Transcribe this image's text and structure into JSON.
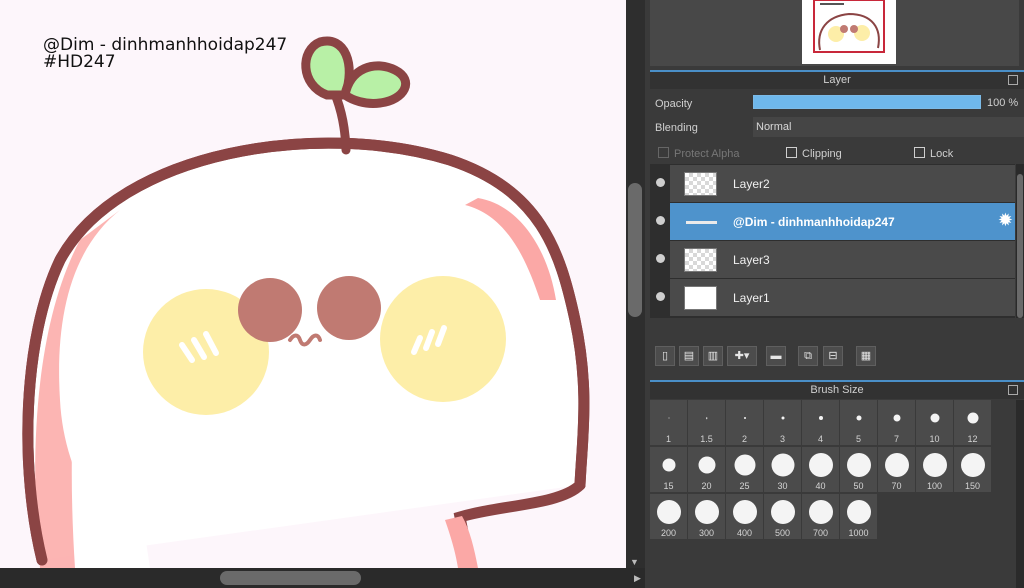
{
  "canvas": {
    "watermark_line1": "@Dim - dinhmanhhoidap247",
    "watermark_line2": "#HD247",
    "background_color": "#fdf6fb"
  },
  "layer_panel": {
    "title": "Layer",
    "opacity_label": "Opacity",
    "opacity_value": "100 %",
    "opacity_fraction": 1.0,
    "blending_label": "Blending",
    "blending_value": "Normal",
    "protect_alpha_label": "Protect Alpha",
    "clipping_label": "Clipping",
    "lock_label": "Lock",
    "layers": [
      {
        "name": "Layer2",
        "selected": false
      },
      {
        "name": "@Dim - dinhmanhhoidap247",
        "selected": true
      },
      {
        "name": "Layer3",
        "selected": false
      },
      {
        "name": "Layer1",
        "selected": false
      }
    ]
  },
  "brush_panel": {
    "title": "Brush Size",
    "sizes": [
      "1",
      "1.5",
      "2",
      "3",
      "4",
      "5",
      "7",
      "10",
      "12",
      "15",
      "20",
      "25",
      "30",
      "40",
      "50",
      "70",
      "100",
      "150",
      "200",
      "300",
      "400",
      "500",
      "700",
      "1000"
    ]
  },
  "colors": {
    "accent": "#4e93cc",
    "panel_bg": "#3a3a3a",
    "outline": "#8b4444",
    "cheek": "#fdeea8",
    "eye": "#c07a72",
    "leaf": "#b8f0a6",
    "pink_shade": "#fba8a6"
  },
  "icons": [
    "new-layer-icon",
    "new-raster-icon",
    "new-text-icon",
    "add-layer-dropdown-icon",
    "folder-icon",
    "duplicate-layer-icon",
    "merge-layer-icon",
    "delete-layer-icon",
    "gear-icon",
    "popout-icon"
  ]
}
